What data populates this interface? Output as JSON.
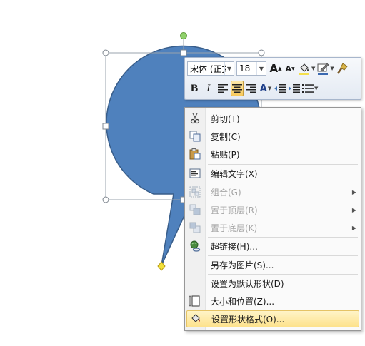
{
  "mini_toolbar": {
    "font_name": "宋体 (正文",
    "font_size": "18",
    "grow_font_glyph": "A",
    "shrink_font_glyph": "A",
    "bold_glyph": "B",
    "italic_glyph": "I",
    "font_color_glyph": "A"
  },
  "context_menu": {
    "items": [
      {
        "label": "剪切(T)",
        "icon": "scissors-icon",
        "enabled": true
      },
      {
        "label": "复制(C)",
        "icon": "copy-icon",
        "enabled": true
      },
      {
        "label": "粘贴(P)",
        "icon": "paste-icon",
        "enabled": true
      },
      {
        "label": "编辑文字(X)",
        "icon": "edit-text-icon",
        "enabled": true
      },
      {
        "label": "组合(G)",
        "icon": "group-icon",
        "enabled": false
      },
      {
        "label": "置于顶层(R)",
        "icon": "bring-to-front-icon",
        "enabled": false
      },
      {
        "label": "置于底层(K)",
        "icon": "send-to-back-icon",
        "enabled": false
      },
      {
        "label": "超链接(H)...",
        "icon": "hyperlink-icon",
        "enabled": true
      },
      {
        "label": "另存为图片(S)...",
        "enabled": true
      },
      {
        "label": "设置为默认形状(D)",
        "enabled": true
      },
      {
        "label": "大小和位置(Z)...",
        "icon": "size-position-icon",
        "enabled": true
      },
      {
        "label": "设置形状格式(O)...",
        "icon": "format-shape-icon",
        "enabled": true,
        "highlighted": true
      }
    ]
  },
  "colors": {
    "shape_fill": "#4f81bd",
    "shape_outline": "#385d8a",
    "rotation_handle": "#8fd16b",
    "adjust_handle": "#f2e13a",
    "menu_highlight": "#fde28c"
  }
}
